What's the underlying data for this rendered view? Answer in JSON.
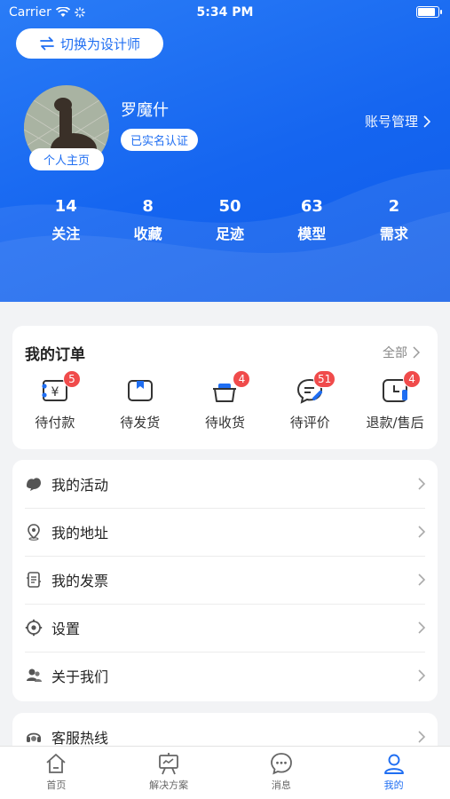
{
  "status_bar": {
    "carrier": "Carrier",
    "time": "5:34 PM"
  },
  "header": {
    "switch_button": "切换为设计师",
    "user_name": "罗魔什",
    "verified_badge": "已实名认证",
    "home_tag": "个人主页",
    "account_link": "账号管理",
    "stats": [
      {
        "value": "14",
        "label": "关注"
      },
      {
        "value": "8",
        "label": "收藏"
      },
      {
        "value": "50",
        "label": "足迹"
      },
      {
        "value": "63",
        "label": "模型"
      },
      {
        "value": "2",
        "label": "需求"
      }
    ]
  },
  "orders": {
    "title": "我的订单",
    "all_link": "全部",
    "items": [
      {
        "label": "待付款",
        "badge": "5",
        "icon": "payment-icon"
      },
      {
        "label": "待发货",
        "badge": "",
        "icon": "package-icon"
      },
      {
        "label": "待收货",
        "badge": "4",
        "icon": "basket-icon"
      },
      {
        "label": "待评价",
        "badge": "51",
        "icon": "comment-icon"
      },
      {
        "label": "退款/售后",
        "badge": "4",
        "icon": "clock-icon"
      }
    ]
  },
  "menu": {
    "items": [
      {
        "label": "我的活动",
        "icon": "activity-icon"
      },
      {
        "label": "我的地址",
        "icon": "location-icon"
      },
      {
        "label": "我的发票",
        "icon": "invoice-icon"
      },
      {
        "label": "设置",
        "icon": "settings-icon"
      },
      {
        "label": "关于我们",
        "icon": "about-icon"
      }
    ],
    "hotline": {
      "label": "客服热线",
      "icon": "headset-icon"
    }
  },
  "tabbar": {
    "tabs": [
      {
        "label": "首页",
        "icon": "home-icon",
        "active": false
      },
      {
        "label": "解决方案",
        "icon": "easel-icon",
        "active": false
      },
      {
        "label": "消息",
        "icon": "message-icon",
        "active": false
      },
      {
        "label": "我的",
        "icon": "profile-icon",
        "active": true
      }
    ]
  },
  "colors": {
    "primary": "#1f6ef2",
    "badge": "#f04b4b",
    "background": "#f2f3f5"
  }
}
